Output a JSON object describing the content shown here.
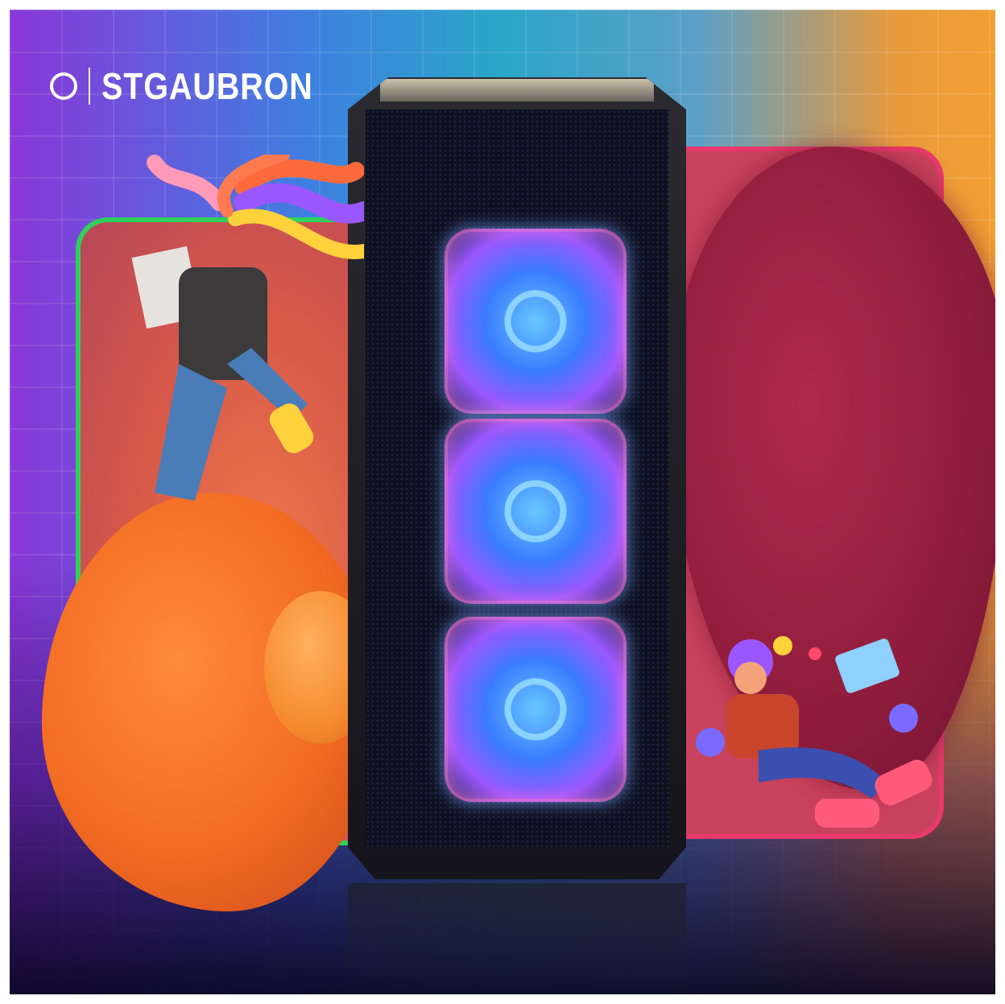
{
  "brand": {
    "name": "STGAUBRON",
    "icon": "circle-logo-icon"
  },
  "scene": {
    "colors": {
      "background_left": "#8a36d8",
      "background_right": "#f2a033",
      "panel_left_border": "#2fd15a",
      "panel_right_border": "#e8386c",
      "fan_glow": "#69c7ff"
    }
  }
}
